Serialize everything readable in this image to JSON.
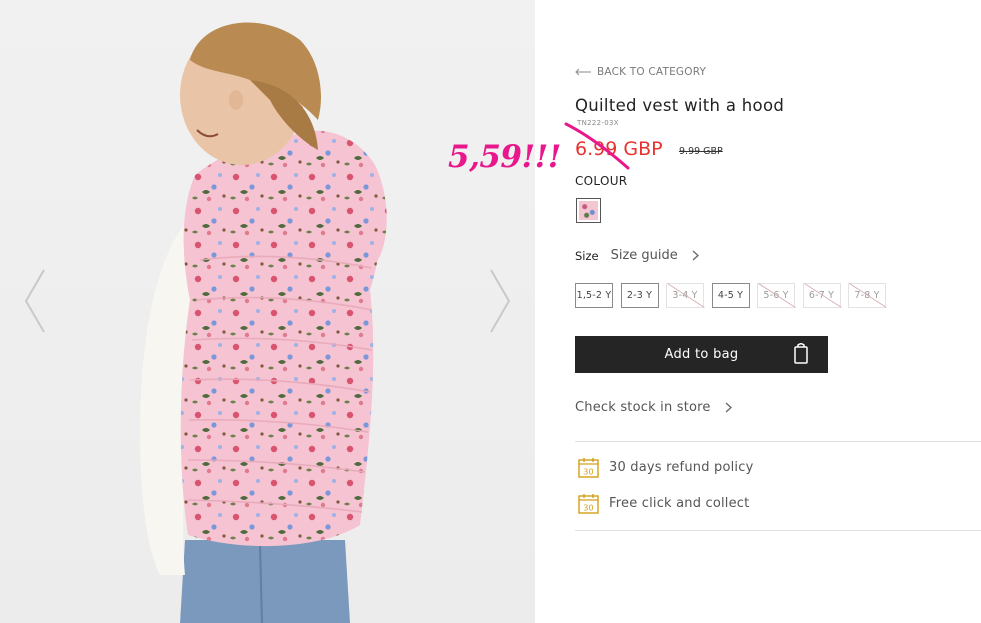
{
  "product": {
    "back_label": "BACK TO CATEGORY",
    "title": "Quilted vest with a hood",
    "sku": "TN222-03X",
    "price": "6.99 GBP",
    "old_price": "9.99 GBP",
    "colour_label": "COLOUR",
    "size_label": "Size",
    "size_guide_label": "Size guide",
    "sizes": [
      {
        "label": "1,5-2 Y",
        "available": true
      },
      {
        "label": "2-3 Y",
        "available": true
      },
      {
        "label": "3-4 Y",
        "available": false
      },
      {
        "label": "4-5 Y",
        "available": true
      },
      {
        "label": "5-6 Y",
        "available": false
      },
      {
        "label": "6-7 Y",
        "available": false
      },
      {
        "label": "7-8 Y",
        "available": false
      }
    ],
    "add_to_bag_label": "Add to bag",
    "check_stock_label": "Check stock in store",
    "perks": [
      {
        "icon": "calendar-30-icon",
        "label": "30 days refund policy",
        "badge": "30"
      },
      {
        "icon": "calendar-30-icon",
        "label": "Free click and collect",
        "badge": "30"
      }
    ]
  },
  "annotation": {
    "handwritten_price": "5,59!!!"
  },
  "colors": {
    "price_red": "#e8322f",
    "annotation_pink": "#e8188c",
    "button_dark": "#252525",
    "perk_icon_gold": "#d4a017"
  }
}
